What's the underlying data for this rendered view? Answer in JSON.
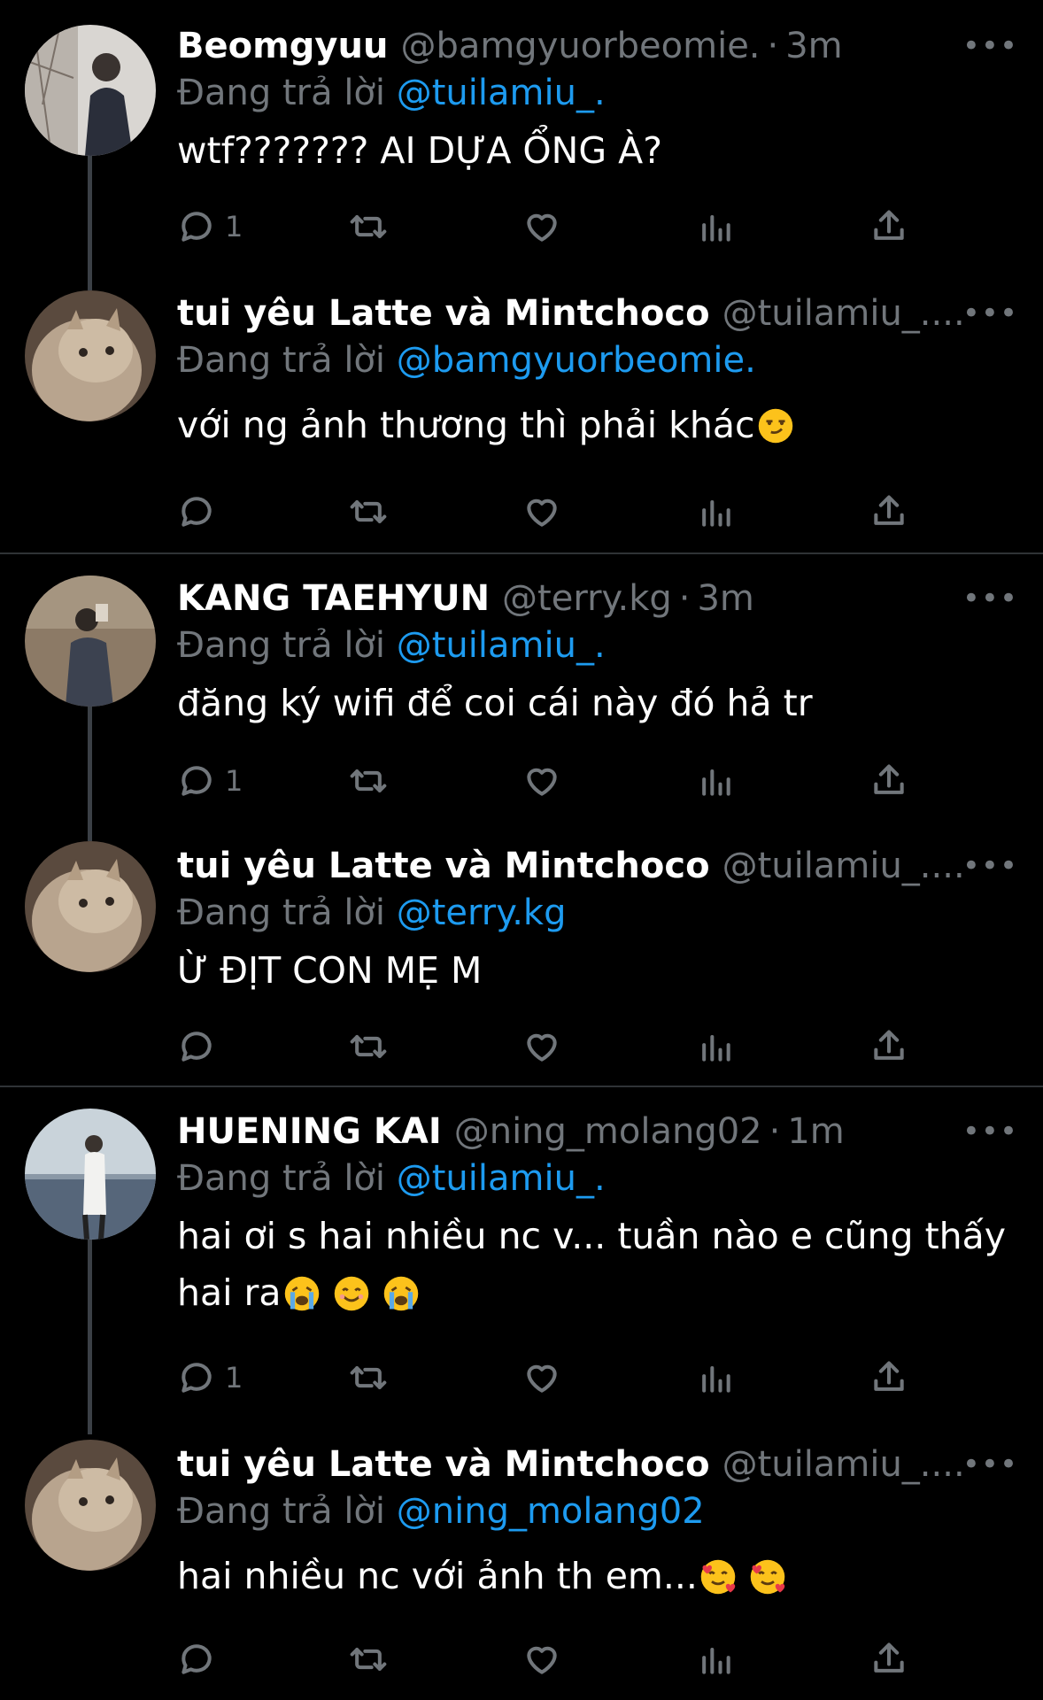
{
  "reply_prefix": "Đang trả lời",
  "more_label": "•••",
  "tweets": [
    {
      "name": "Beomgyuu",
      "handle": "@bamgyuorbeomie.",
      "sep": "·",
      "time": "3m",
      "reply_to": "@tuilamiu_.",
      "text": "wtf??????? AI DỰA ỔNG À?",
      "reply_count": "1"
    },
    {
      "name": "tui yêu Latte và Mintchoco",
      "handle": "@tuilamiu_....",
      "sep": "",
      "time": "",
      "reply_to": "@bamgyuorbeomie.",
      "text": "với ng ảnh thương thì phải khác",
      "reply_count": ""
    },
    {
      "name": "KANG TAEHYUN",
      "handle": "@terry.kg",
      "sep": "·",
      "time": "3m",
      "reply_to": "@tuilamiu_.",
      "text": "đăng ký wifi để coi cái này đó hả tr",
      "reply_count": "1"
    },
    {
      "name": "tui yêu Latte và Mintchoco",
      "handle": "@tuilamiu_....",
      "sep": "",
      "time": "",
      "reply_to": "@terry.kg",
      "text": "Ừ ĐỊT CON MẸ M",
      "reply_count": ""
    },
    {
      "name": "HUENING KAI",
      "handle": "@ning_molang02",
      "sep": "·",
      "time": "1m",
      "reply_to": "@tuilamiu_.",
      "text1": "hai ơi s hai nhiều nc v... tuần nào e cũng thấy",
      "text2": "hai ra",
      "reply_count": "1"
    },
    {
      "name": "tui yêu Latte và Mintchoco",
      "handle": "@tuilamiu_....",
      "sep": "",
      "time": "",
      "reply_to": "@ning_molang02",
      "text": "hai nhiều nc với ảnh th em...",
      "reply_count": ""
    }
  ]
}
